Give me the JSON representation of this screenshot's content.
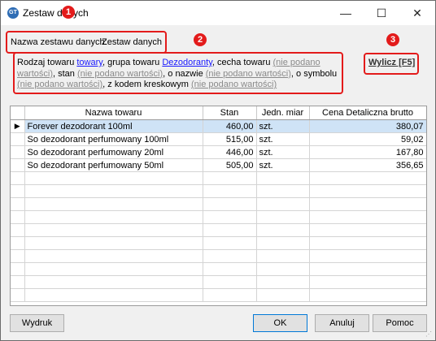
{
  "window": {
    "title": "Zestaw danych",
    "icon_glyph": "GT",
    "controls": {
      "minimize": "—",
      "maximize": "☐",
      "close": "✕"
    }
  },
  "annotations": [
    "1",
    "2",
    "3"
  ],
  "dataset": {
    "name_label": "Nazwa zestawu danych:",
    "name_value": "Zestaw danych"
  },
  "description": {
    "p1": "Rodzaj towaru ",
    "kind": "towary",
    "p2": ", grupa towaru ",
    "group": "Dezodoranty",
    "p3": ", cecha towaru ",
    "feature": "(nie podano wartości)",
    "p4": ", stan ",
    "state": "(nie podano wartości)",
    "p5": ", o nazwie ",
    "name": "(nie podano wartości)",
    "p6": ", o symbolu ",
    "symbol": "(nie podano wartości)",
    "p7": ", z kodem kreskowym ",
    "barcode": "(nie podano wartości)"
  },
  "calc_button": "Wylicz [F5]",
  "table": {
    "columns": [
      "Nazwa towaru",
      "Stan",
      "Jedn. miar",
      "Cena Detaliczna brutto"
    ],
    "current_row_marker": "▶",
    "rows": [
      {
        "name": "Forever dezodorant 100ml",
        "stock": "460,00",
        "unit": "szt.",
        "price": "380,07"
      },
      {
        "name": "So dezodorant perfumowany 100ml",
        "stock": "515,00",
        "unit": "szt.",
        "price": "59,02"
      },
      {
        "name": "So dezodorant perfumowany 20ml",
        "stock": "446,00",
        "unit": "szt.",
        "price": "167,80"
      },
      {
        "name": "So dezodorant perfumowany 50ml",
        "stock": "505,00",
        "unit": "szt.",
        "price": "356,65"
      }
    ]
  },
  "buttons": {
    "print": "Wydruk",
    "ok": "OK",
    "cancel": "Anuluj",
    "help": "Pomoc"
  },
  "colors": {
    "annotation": "#e31b1b",
    "selected_row": "#cfe3f6",
    "link": "#1a1aff",
    "placeholder": "#8a8a8a"
  }
}
